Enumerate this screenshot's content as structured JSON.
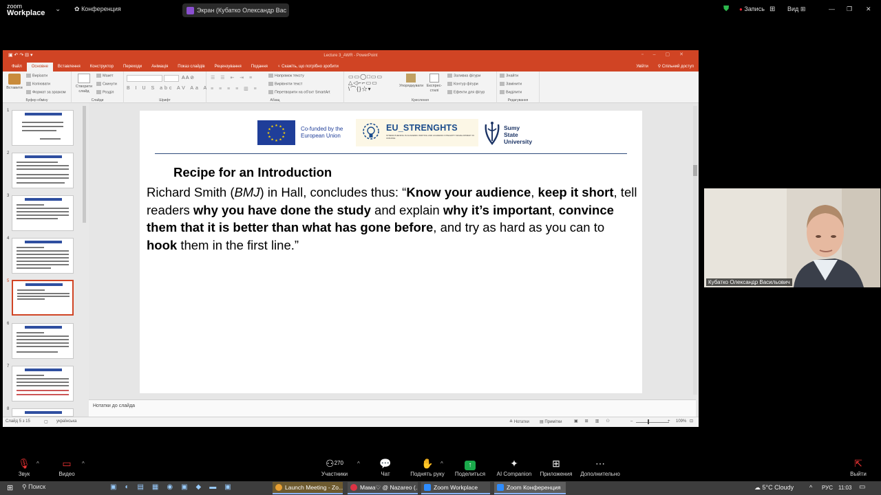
{
  "zoom_top": {
    "logo_line1": "zoom",
    "logo_line2": "Workplace",
    "conference_label": "Конференция",
    "share_label": "Экран (Кубатко Олександр Вас",
    "record_label": "Запись",
    "view_label": "Вид"
  },
  "powerpoint": {
    "window_title": "Lecture 3_AWR - PowerPoint",
    "tabs": [
      "Файл",
      "Основне",
      "Вставлення",
      "Конструктор",
      "Переходи",
      "Анімація",
      "Показ слайдів",
      "Рецензування",
      "Подання"
    ],
    "tell_me": "Скажіть, що потрібно зробити",
    "sign_in": "Увійти",
    "share": "Спільний доступ",
    "ribbon": {
      "paste": "Вставити",
      "cut": "Вирізати",
      "copy": "Копіювати",
      "format_painter": "Формат за зразком",
      "clipboard_group": "Буфер обміну",
      "new_slide": "Створити слайд",
      "layout": "Макет",
      "reset": "Скинути",
      "section": "Розділ",
      "slides_group": "Слайди",
      "font_group": "Шрифт",
      "text_direction": "Напрямок тексту",
      "align_text": "Вирівняти текст",
      "convert_smartart": "Перетворити на об'єкт SmartArt",
      "paragraph_group": "Абзац",
      "arrange": "Упорядкувати",
      "quick_styles": "Експрес-стилі",
      "shape_fill": "Заливка фігури",
      "shape_outline": "Контур фігури",
      "shape_effects": "Ефекти для фігур",
      "drawing_group": "Креслення",
      "find": "Знайти",
      "replace": "Замінити",
      "select": "Виділити",
      "editing_group": "Редагування"
    },
    "thumb_numbers": [
      "1",
      "2",
      "3",
      "4",
      "5",
      "6",
      "7",
      "8"
    ],
    "notes_placeholder": "Нотатки до слайда",
    "status": {
      "slide_info": "Слайд 5 з 15",
      "language": "українська",
      "notes": "Нотатки",
      "comments": "Примітки",
      "zoom": "109%"
    }
  },
  "slide": {
    "cofunded_line1": "Co-funded by the",
    "cofunded_line2": "European Union",
    "eu_strenghts": "EU_STRENGHTS",
    "eu_strenghts_sub": "STRENGTHENING IN ACADEMIC WRITING AND ACADEMIC INTEGRITY DEVELOPMENT IN UKRAINE",
    "sumy_line1": "Sumy",
    "sumy_line2": "State",
    "sumy_line3": "University",
    "title": "Recipe for an Introduction",
    "body": {
      "p1": "Richard Smith (",
      "p2": "BMJ",
      "p3": ") in Hall, concludes thus: “",
      "p4": "Know your audience",
      "p5": ", ",
      "p6": "keep it short",
      "p7": ", tell readers ",
      "p8": "why you have done the study",
      "p9": " and explain ",
      "p10": "why it’s important",
      "p11": ", ",
      "p12": "convince them that it is better than what has gone before",
      "p13": ", and try as hard as you can to ",
      "p14": "hook",
      "p15": " them in the first line.”"
    }
  },
  "webcam": {
    "name": "Кубатко Олександр Васильович"
  },
  "zoom_toolbar": {
    "audio": "Звук",
    "video": "Видео",
    "participants": "Участники",
    "participants_count": "270",
    "chat": "Чат",
    "raise_hand": "Поднять руку",
    "share": "Поделиться",
    "ai": "AI Companion",
    "apps": "Приложения",
    "more": "Дополнительно",
    "leave": "Выйти"
  },
  "taskbar": {
    "search": "Поиск",
    "item1": "Launch Meeting - Zo...",
    "item2": "Мама♡ @ Nazareo (...",
    "item3": "Zoom Workplace",
    "item4": "Zoom Конференция",
    "weather": "5°C  Cloudy",
    "lang": "РУС",
    "time": "11:03"
  },
  "colors": {
    "ppt_accent": "#d04424",
    "eu_blue": "#1f3e99",
    "zoom_green": "#1aaa4b"
  }
}
